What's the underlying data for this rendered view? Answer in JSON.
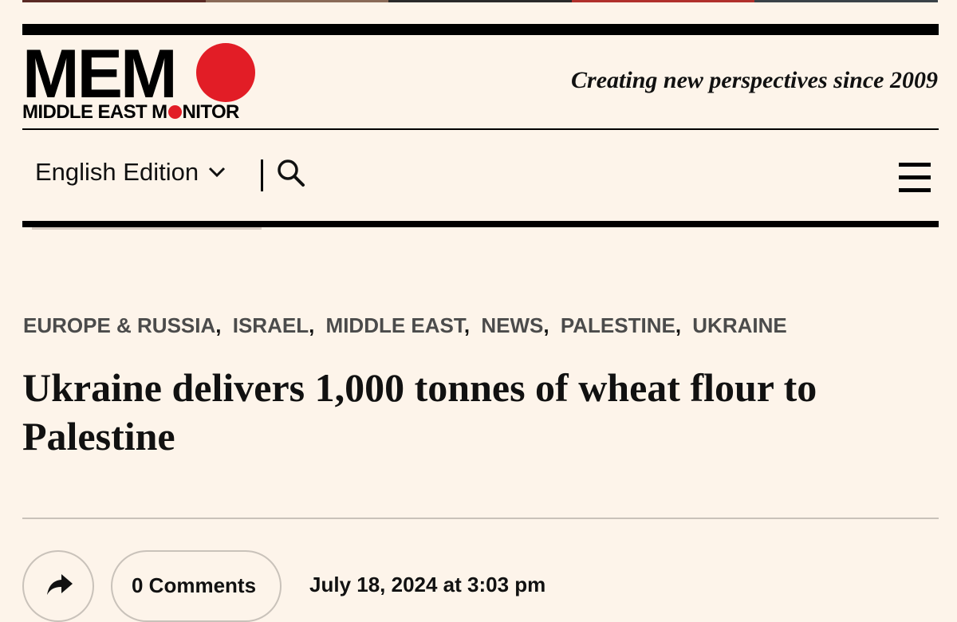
{
  "header": {
    "logo_word": "MEM",
    "logo_subtitle_before": "MIDDLE EAST M",
    "logo_subtitle_after": "NITOR",
    "tagline": "Creating new perspectives since 2009",
    "brand_color": "#e21d26"
  },
  "nav": {
    "edition_label": "English Edition",
    "icons": [
      "chevron-down-icon",
      "search-icon",
      "hamburger-menu-icon"
    ]
  },
  "article": {
    "categories": [
      "EUROPE & RUSSIA",
      "ISRAEL",
      "MIDDLE EAST",
      "NEWS",
      "PALESTINE",
      "UKRAINE"
    ],
    "headline": "Ukraine delivers 1,000 tonnes of wheat flour to Palestine",
    "comments_label": "0 Comments",
    "date": "July 18, 2024 at 3:03 pm",
    "icons": [
      "share-icon"
    ]
  }
}
